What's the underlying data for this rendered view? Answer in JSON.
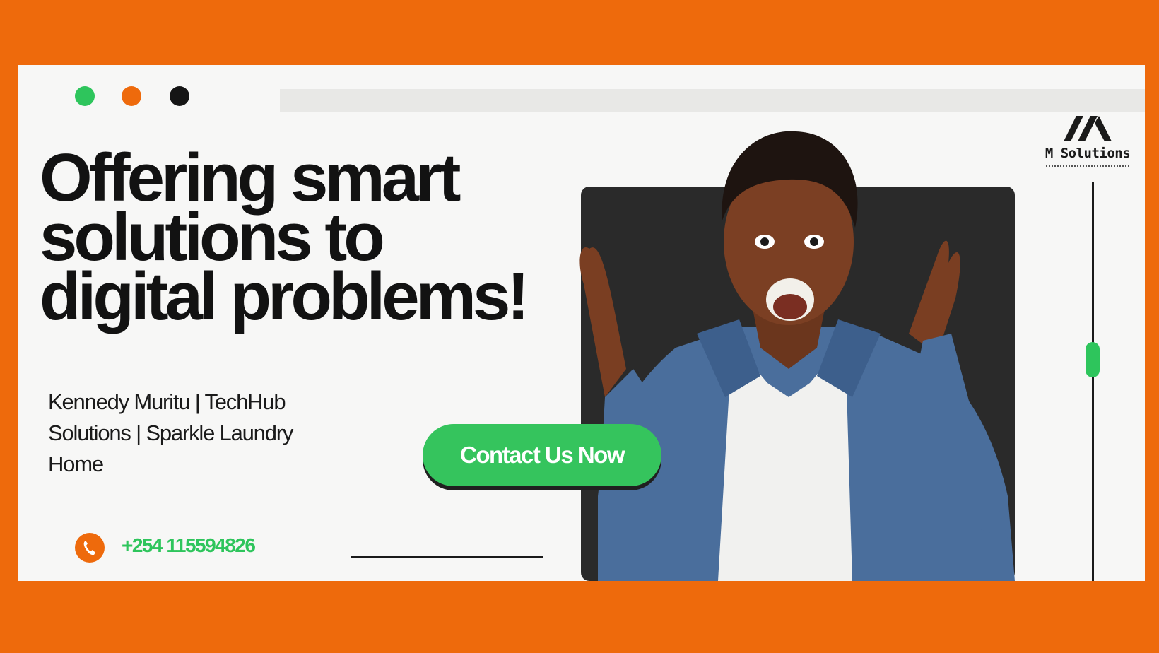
{
  "banner": {
    "headline_line1": "Offering smart",
    "headline_line2": "solutions to",
    "headline_line3": "digital problems!",
    "subtitle_line1": "Kennedy Muritu |  TechHub",
    "subtitle_line2": "Solutions  |  Sparkle Laundry",
    "subtitle_line3": "Home",
    "cta_label": "Contact Us Now",
    "phone_icon": "phone-icon",
    "phone_number": "+254 115594826"
  },
  "logo": {
    "name": "M Solutions"
  },
  "colors": {
    "accent_orange": "#ee6a0c",
    "accent_green": "#35c45d",
    "text_dark": "#121212"
  }
}
